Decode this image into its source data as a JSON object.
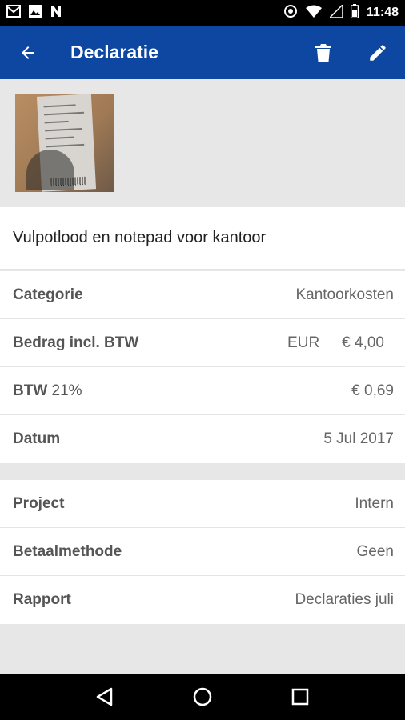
{
  "status_bar": {
    "time": "11:48",
    "left_icons": [
      "mail-icon",
      "image-icon",
      "n-app-icon"
    ],
    "right_icons": [
      "sync-icon",
      "wifi-icon",
      "signal-icon",
      "battery-icon"
    ]
  },
  "app_bar": {
    "title": "Declaratie",
    "color": "#0d47a1",
    "back_icon": "arrow-back-icon",
    "actions": [
      "delete-icon",
      "edit-icon"
    ]
  },
  "receipt_image": {
    "icon": "receipt-photo"
  },
  "description": "Vulpotlood en notepad voor kantoor",
  "details": {
    "category": {
      "label": "Categorie",
      "value": "Kantoorkosten"
    },
    "amount": {
      "label": "Bedrag incl. BTW",
      "currency": "EUR",
      "value": "€ 4,00"
    },
    "vat": {
      "label": "BTW",
      "rate": "21%",
      "value": "€ 0,69"
    },
    "date": {
      "label": "Datum",
      "value": "5 Jul 2017"
    }
  },
  "extra": {
    "project": {
      "label": "Project",
      "value": "Intern"
    },
    "payment_method": {
      "label": "Betaalmethode",
      "value": "Geen"
    },
    "report": {
      "label": "Rapport",
      "value": "Declaraties juli"
    }
  },
  "nav_bar": {
    "icons": [
      "nav-back-icon",
      "nav-home-icon",
      "nav-recents-icon"
    ]
  }
}
